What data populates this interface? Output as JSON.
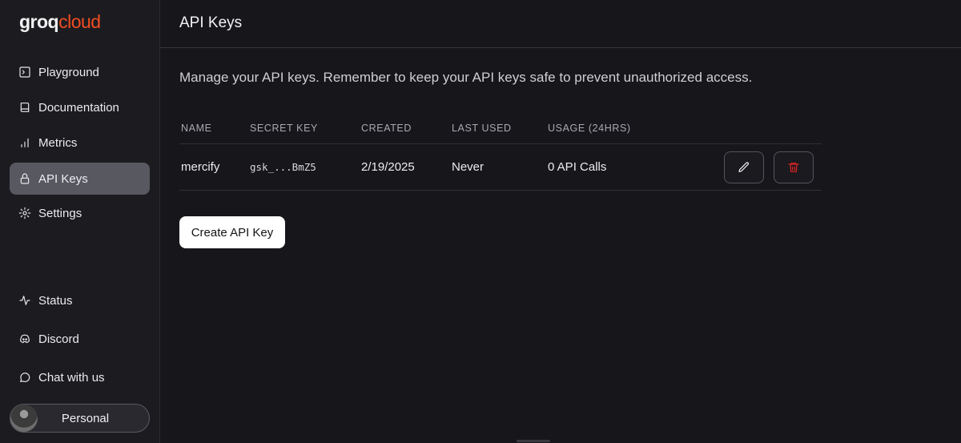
{
  "brand": {
    "part1": "groq",
    "part2": "cloud"
  },
  "sidebar": {
    "items": [
      {
        "label": "Playground",
        "icon": "terminal-icon"
      },
      {
        "label": "Documentation",
        "icon": "book-icon"
      },
      {
        "label": "Metrics",
        "icon": "bar-chart-icon"
      },
      {
        "label": "API Keys",
        "icon": "lock-icon",
        "active": true
      },
      {
        "label": "Settings",
        "icon": "gear-icon"
      }
    ],
    "bottom_items": [
      {
        "label": "Status",
        "icon": "activity-icon"
      },
      {
        "label": "Discord",
        "icon": "discord-icon"
      },
      {
        "label": "Chat with us",
        "icon": "chat-icon"
      }
    ],
    "workspace": "Personal"
  },
  "header": {
    "title": "API Keys"
  },
  "main": {
    "description": "Manage your API keys. Remember to keep your API keys safe to prevent unauthorized access.",
    "table": {
      "columns": [
        "NAME",
        "SECRET KEY",
        "CREATED",
        "LAST USED",
        "USAGE (24HRS)"
      ],
      "rows": [
        {
          "name": "mercify",
          "secret": "gsk_...BmZ5",
          "created": "2/19/2025",
          "last_used": "Never",
          "usage": "0 API Calls"
        }
      ]
    },
    "create_button": "Create API Key"
  },
  "colors": {
    "accent": "#f04e23",
    "delete": "#e02424",
    "active_nav": "#585861"
  }
}
